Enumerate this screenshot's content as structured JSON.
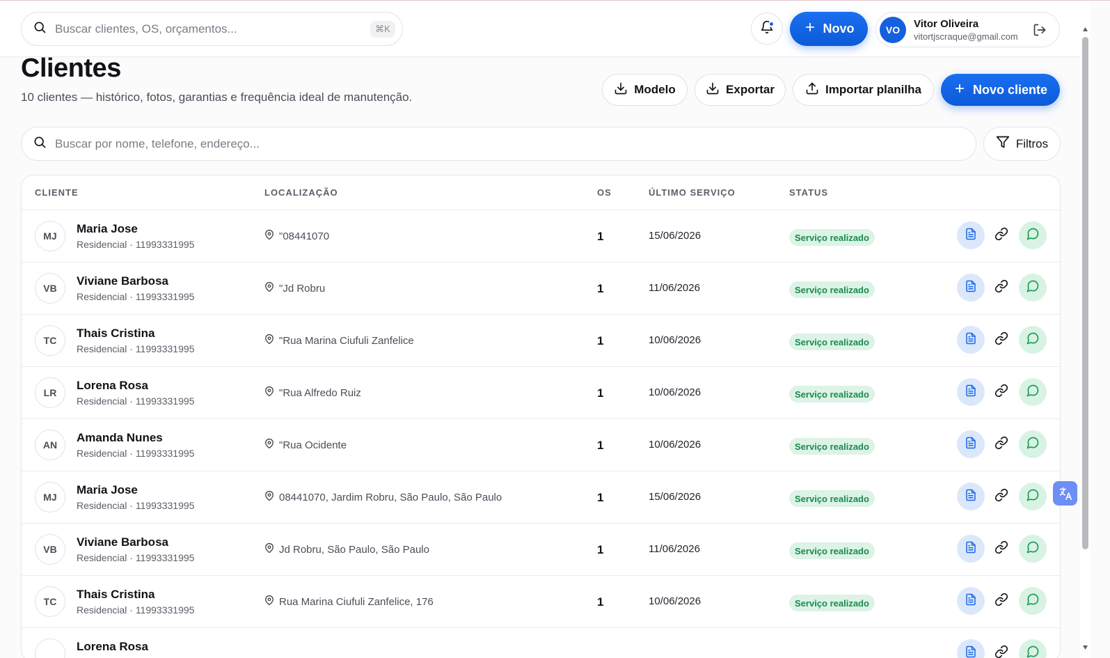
{
  "topbar": {
    "search_placeholder": "Buscar clientes, OS, orçamentos...",
    "search_shortcut": "⌘K",
    "new_button_label": "Novo",
    "user": {
      "initials": "VO",
      "name": "Vitor Oliveira",
      "email": "vitortjscraque@gmail.com"
    }
  },
  "page": {
    "title": "Clientes",
    "subtitle": "10 clientes — histórico, fotos, garantias e frequência ideal de manutenção.",
    "actions": {
      "modelo": "Modelo",
      "exportar": "Exportar",
      "importar": "Importar planilha",
      "novo_cliente": "Novo cliente"
    },
    "search_placeholder": "Buscar por nome, telefone, endereço...",
    "filters_label": "Filtros"
  },
  "table": {
    "columns": {
      "cliente": "CLIENTE",
      "localizacao": "LOCALIZAÇÃO",
      "os": "OS",
      "ultimo_servico": "ÚLTIMO SERVIÇO",
      "status": "STATUS"
    },
    "rows": [
      {
        "initials": "MJ",
        "name": "Maria Jose",
        "sub": "Residencial · 11993331995",
        "location": "\"08441070",
        "os": "1",
        "last_service": "15/06/2026",
        "status": "Serviço realizado"
      },
      {
        "initials": "VB",
        "name": "Viviane Barbosa",
        "sub": "Residencial · 11993331995",
        "location": "\"Jd Robru",
        "os": "1",
        "last_service": "11/06/2026",
        "status": "Serviço realizado"
      },
      {
        "initials": "TC",
        "name": "Thais Cristina",
        "sub": "Residencial · 11993331995",
        "location": "\"Rua Marina Ciufuli Zanfelice",
        "os": "1",
        "last_service": "10/06/2026",
        "status": "Serviço realizado"
      },
      {
        "initials": "LR",
        "name": "Lorena Rosa",
        "sub": "Residencial · 11993331995",
        "location": "\"Rua Alfredo Ruiz",
        "os": "1",
        "last_service": "10/06/2026",
        "status": "Serviço realizado"
      },
      {
        "initials": "AN",
        "name": "Amanda Nunes",
        "sub": "Residencial · 11993331995",
        "location": "\"Rua Ocidente",
        "os": "1",
        "last_service": "10/06/2026",
        "status": "Serviço realizado"
      },
      {
        "initials": "MJ",
        "name": "Maria Jose",
        "sub": "Residencial · 11993331995",
        "location": "08441070, Jardim Robru, São Paulo, São Paulo",
        "os": "1",
        "last_service": "15/06/2026",
        "status": "Serviço realizado"
      },
      {
        "initials": "VB",
        "name": "Viviane Barbosa",
        "sub": "Residencial · 11993331995",
        "location": "Jd Robru, São Paulo, São Paulo",
        "os": "1",
        "last_service": "11/06/2026",
        "status": "Serviço realizado"
      },
      {
        "initials": "TC",
        "name": "Thais Cristina",
        "sub": "Residencial · 11993331995",
        "location": "Rua Marina Ciufuli Zanfelice, 176",
        "os": "1",
        "last_service": "10/06/2026",
        "status": "Serviço realizado"
      },
      {
        "initials": "",
        "name": "Lorena Rosa",
        "sub": "",
        "location": "",
        "os": "",
        "last_service": "",
        "status": ""
      }
    ]
  },
  "colors": {
    "primary": "#1a66e8",
    "status_bg": "#dcf3e6",
    "status_text": "#1b8a4e",
    "doc_action_bg": "#dbe8fb",
    "wa_action_bg": "#d8f3e3"
  }
}
